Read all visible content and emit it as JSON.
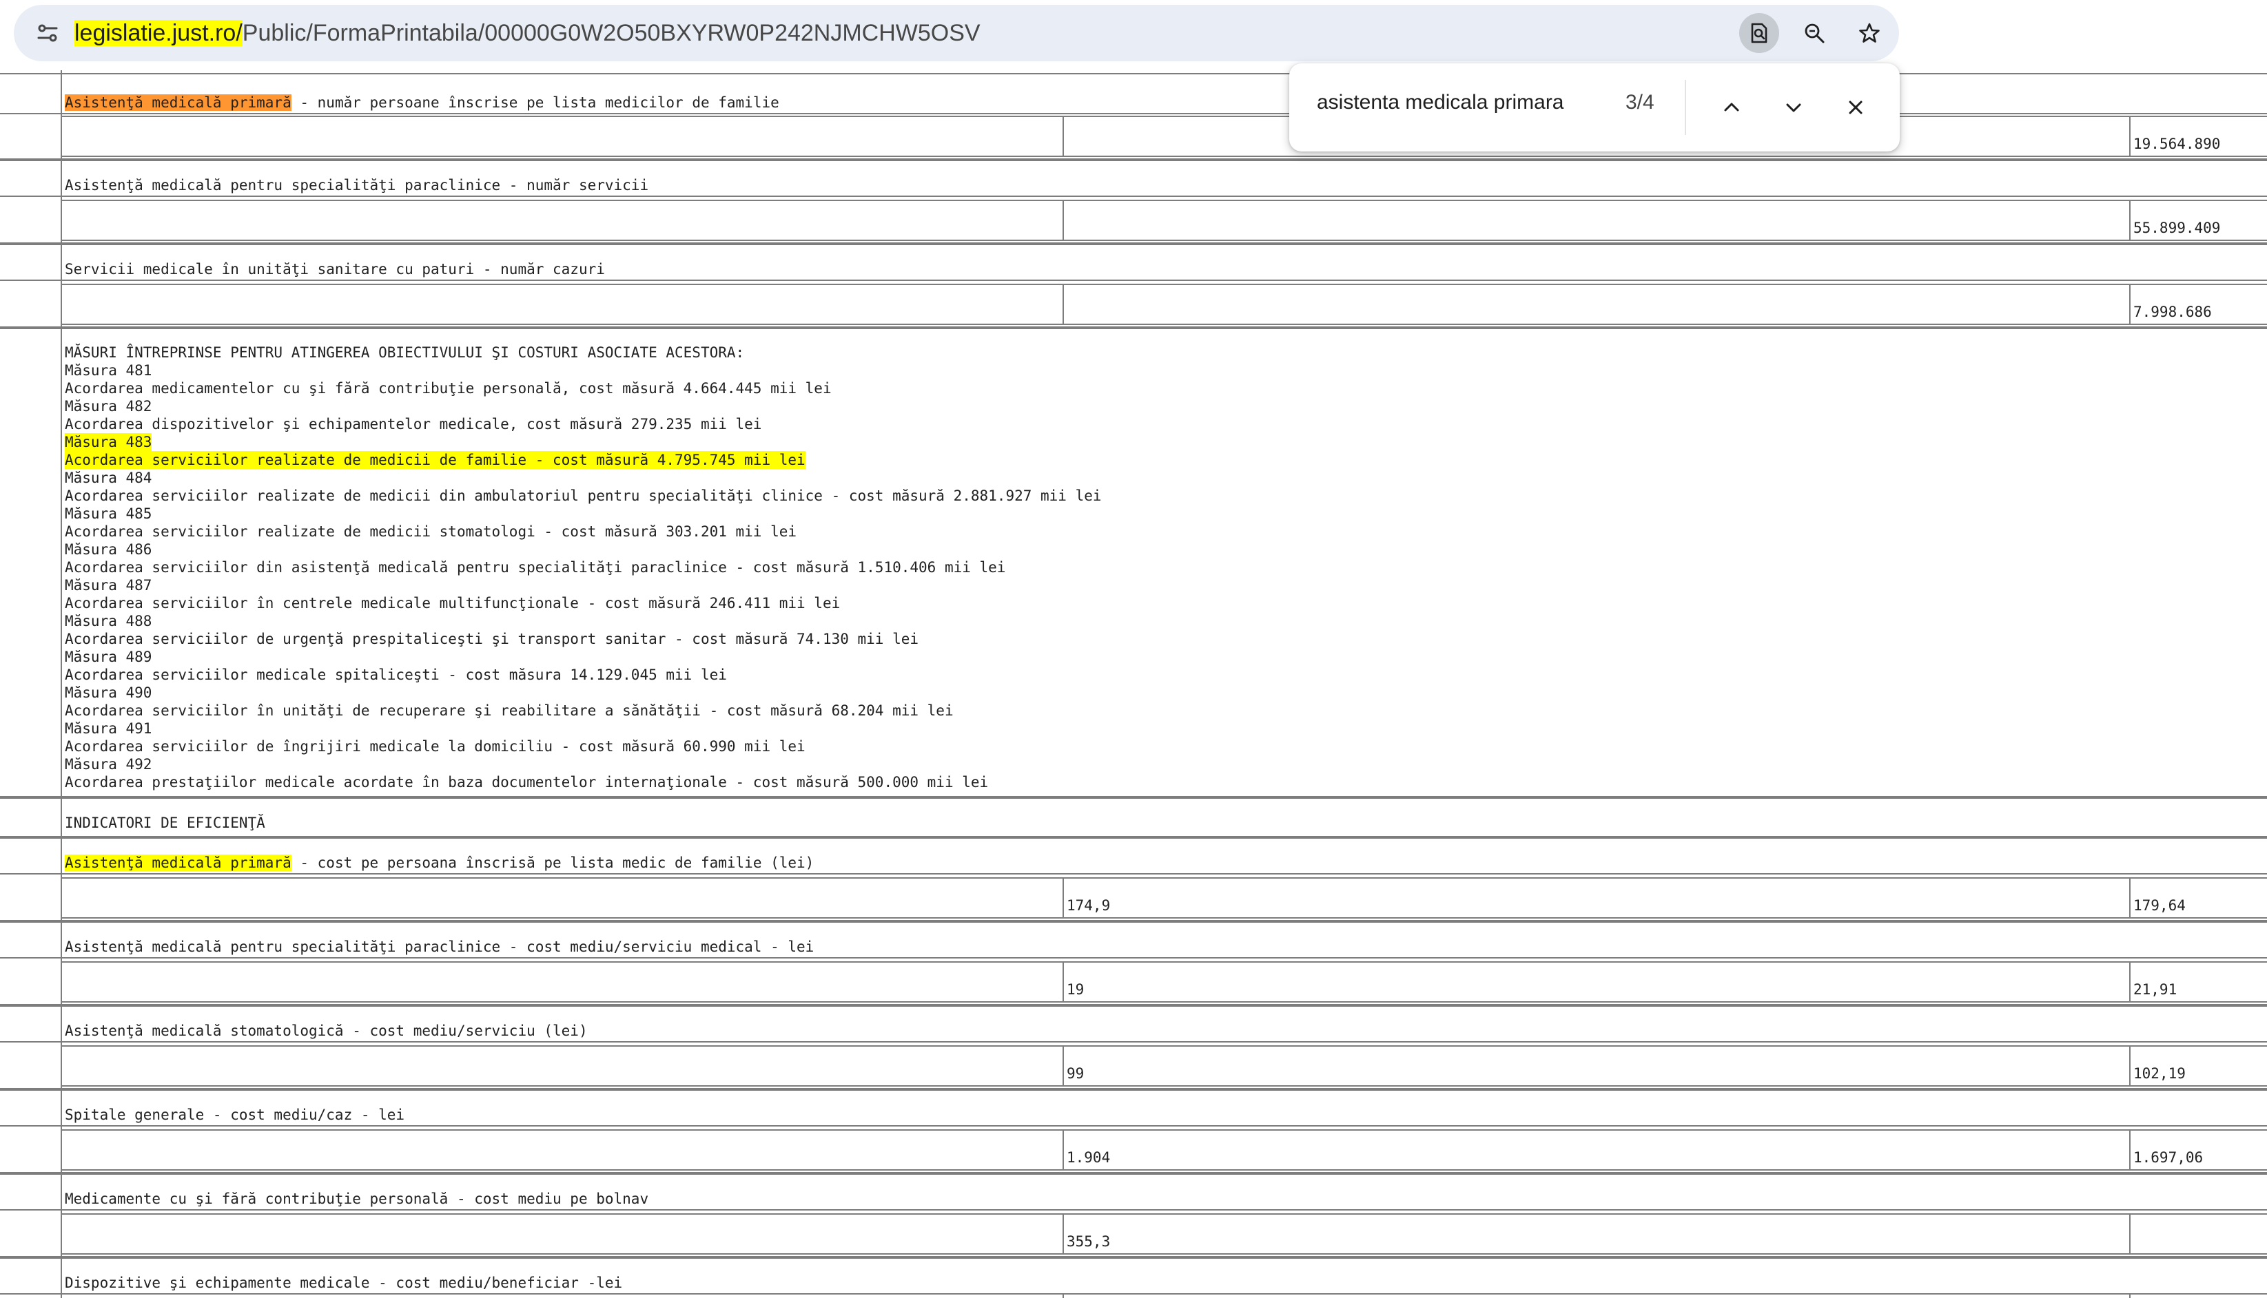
{
  "browser": {
    "url_host": "legislatie.just.ro/",
    "url_path": "Public/FormaPrintabila/00000G0W2O50BXYRW0P242NJMCHW5OSV",
    "icons": [
      "site-info-icon",
      "find-in-page-icon",
      "zoom-icon",
      "bookmark-star-icon"
    ]
  },
  "find_bar": {
    "query": "asistenta medicala primara",
    "count": "3/4",
    "icons": [
      "chevron-up-icon",
      "chevron-down-icon",
      "close-icon"
    ]
  },
  "rows": [
    {
      "label_highlight": "Asistenţă medicală primară",
      "label_rest": " - număr persoane înscrise pe lista medicilor de familie",
      "col2": "",
      "col3": "19.564.890"
    },
    {
      "label": "Asistenţă medicală pentru specialităţi paraclinice - număr servicii",
      "col2": "",
      "col3": "55.899.409"
    },
    {
      "label": "Servicii medicale în unităţi sanitare cu paturi - număr cazuri",
      "col2": "",
      "col3": "7.998.686"
    }
  ],
  "measures_heading": "MĂSURI ÎNTREPRINSE PENTRU ATINGEREA OBIECTIVULUI ŞI COSTURI ASOCIATE ACESTORA:",
  "measures": [
    {
      "code": "Măsura 481",
      "text": "Acordarea medicamentelor cu şi fără contribuţie personală, cost măsură 4.664.445 mii lei"
    },
    {
      "code": "Măsura 482",
      "text": "Acordarea dispozitivelor şi echipamentelor medicale, cost măsură 279.235 mii lei"
    },
    {
      "code": "Măsura 483",
      "text": "Acordarea serviciilor realizate de medicii de familie - cost măsură 4.795.745 mii lei",
      "highlighted": true
    },
    {
      "code": "Măsura 484",
      "text": "Acordarea serviciilor realizate de medicii din ambulatoriul pentru specialităţi clinice - cost măsură 2.881.927 mii lei"
    },
    {
      "code": "Măsura 485",
      "text": "Acordarea serviciilor realizate de medicii stomatologi - cost măsură 303.201 mii lei"
    },
    {
      "code": "Măsura 486",
      "text": "Acordarea serviciilor din asistenţă medicală pentru specialităţi paraclinice - cost măsură 1.510.406 mii lei"
    },
    {
      "code": "Măsura 487",
      "text": "Acordarea serviciilor în centrele medicale multifuncţionale - cost măsură 246.411 mii lei"
    },
    {
      "code": "Măsura 488",
      "text": "Acordarea serviciilor de urgenţă prespitaliceşti şi transport sanitar - cost măsură 74.130 mii lei"
    },
    {
      "code": "Măsura 489",
      "text": "Acordarea serviciilor medicale spitaliceşti - cost măsura 14.129.045 mii lei"
    },
    {
      "code": "Măsura 490",
      "text": "Acordarea serviciilor în unităţi de recuperare şi reabilitare a sănătăţii - cost măsură 68.204 mii lei"
    },
    {
      "code": "Măsura 491",
      "text": "Acordarea serviciilor de îngrijiri medicale la domiciliu - cost măsură 60.990 mii lei"
    },
    {
      "code": "Măsura 492",
      "text": "Acordarea prestaţiilor medicale acordate în baza documentelor internaţionale - cost măsură 500.000 mii lei"
    }
  ],
  "efficiency_heading": "INDICATORI DE EFICIENŢĂ",
  "efficiency_rows": [
    {
      "label_highlight": "Asistenţă medicală primară",
      "label_rest": " - cost pe persoana înscrisă pe lista medic de familie (lei)",
      "col2": "174,9",
      "col3": "179,64"
    },
    {
      "label": "Asistenţă medicală pentru specialităţi paraclinice - cost mediu/serviciu medical - lei",
      "col2": "19",
      "col3": "21,91"
    },
    {
      "label": "Asistenţă medicală stomatologică - cost mediu/serviciu (lei)",
      "col2": "99",
      "col3": "102,19"
    },
    {
      "label": "Spitale generale - cost mediu/caz - lei",
      "col2": "1.904",
      "col3": "1.697,06"
    },
    {
      "label": "Medicamente cu şi fără contribuţie personală - cost mediu pe bolnav",
      "col2": "355,3",
      "col3": ""
    },
    {
      "label": "Dispozitive şi echipamente medicale - cost mediu/beneficiar -lei",
      "col2": "",
      "col3": ""
    }
  ],
  "colors": {
    "orange_match": "#ff9632",
    "yellow_match": "#ffff00",
    "omnibox": "#e9eef6"
  }
}
